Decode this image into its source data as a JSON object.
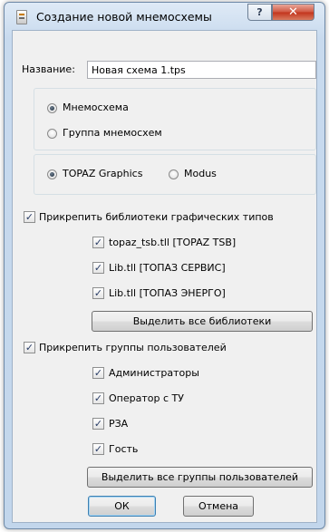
{
  "window": {
    "title": "Создание новой мнемосхемы",
    "help_label": "?",
    "close_label": "✕"
  },
  "name_field": {
    "label": "Название:",
    "value": "Новая схема 1.tps"
  },
  "type_group": {
    "options": [
      {
        "label": "Мнемосхема",
        "checked": true
      },
      {
        "label": "Группа мнемосхем",
        "checked": false
      }
    ]
  },
  "engine_group": {
    "options": [
      {
        "label": "TOPAZ Graphics",
        "checked": true
      },
      {
        "label": "Modus",
        "checked": false
      }
    ]
  },
  "libraries": {
    "attach_label": "Прикрепить библиотеки графических типов",
    "items": [
      {
        "label": "topaz_tsb.tll [TOPAZ TSB]",
        "checked": true
      },
      {
        "label": "Lib.tll [ТОПАЗ СЕРВИС]",
        "checked": true
      },
      {
        "label": "Lib.tll [ТОПАЗ ЭНЕРГО]",
        "checked": true
      }
    ],
    "select_all_label": "Выделить все библиотеки"
  },
  "user_groups": {
    "attach_label": "Прикрепить группы пользователей",
    "items": [
      {
        "label": "Администраторы",
        "checked": true
      },
      {
        "label": "Оператор с ТУ",
        "checked": true
      },
      {
        "label": "РЗА",
        "checked": true
      },
      {
        "label": "Гость",
        "checked": true
      }
    ],
    "select_all_label": "Выделить все группы пользователей"
  },
  "footer": {
    "ok_label": "ОК",
    "cancel_label": "Отмена"
  },
  "check_glyph": "✓"
}
